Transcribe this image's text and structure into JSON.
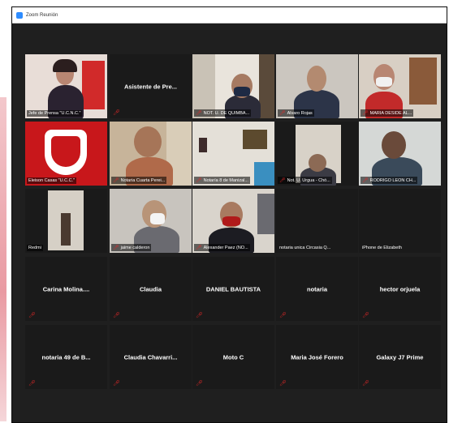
{
  "window": {
    "title": "Zoom Reunión"
  },
  "tiles": [
    {
      "label": "Jefe de Prensa \"U.C.N.C.\"",
      "muted": false
    },
    {
      "name": "Asistente de Pre...",
      "muted": true
    },
    {
      "label": "NOT. U. DE QUIMBA...",
      "muted": true
    },
    {
      "label": "Alvaro Rojas",
      "muted": true
    },
    {
      "label": "MARIA DESIDE AL...",
      "muted": true
    },
    {
      "label": "Eleison Casas \"U.C.C.\"",
      "muted": false
    },
    {
      "label": "Notaria Cuarta Perei...",
      "muted": true
    },
    {
      "label": "Notaría 8 de Manizal...",
      "muted": true
    },
    {
      "label": "Not. U. Urgua - Chó...",
      "muted": true
    },
    {
      "label": "RODRIGO LEON CH...",
      "muted": true
    },
    {
      "label": "Redmi",
      "muted": false
    },
    {
      "label": "jaime calderon",
      "muted": true
    },
    {
      "label": "Alexander Paez (NO...",
      "muted": true
    },
    {
      "label": "notaria unica Circasia Q...",
      "muted": false
    },
    {
      "label": "iPhone de Elizabeth",
      "muted": false
    },
    {
      "name": "Carina Molina....",
      "muted": true
    },
    {
      "name": "Claudia",
      "muted": true
    },
    {
      "name": "DANIEL BAUTISTA",
      "muted": true
    },
    {
      "name": "notaria",
      "muted": true
    },
    {
      "name": "hector orjuela",
      "muted": true
    },
    {
      "name": "notaria 49 de B...",
      "muted": true
    },
    {
      "name": "Claudia Chavarri...",
      "muted": true
    },
    {
      "name": "Moto C",
      "muted": true
    },
    {
      "name": "Maria José Forero",
      "muted": true
    },
    {
      "name": "Galaxy J7 Prime",
      "muted": true
    }
  ],
  "colors": {
    "active_border": "#c6e25a",
    "muted_icon": "#e02828",
    "tile_bg": "#1a1a1a"
  }
}
